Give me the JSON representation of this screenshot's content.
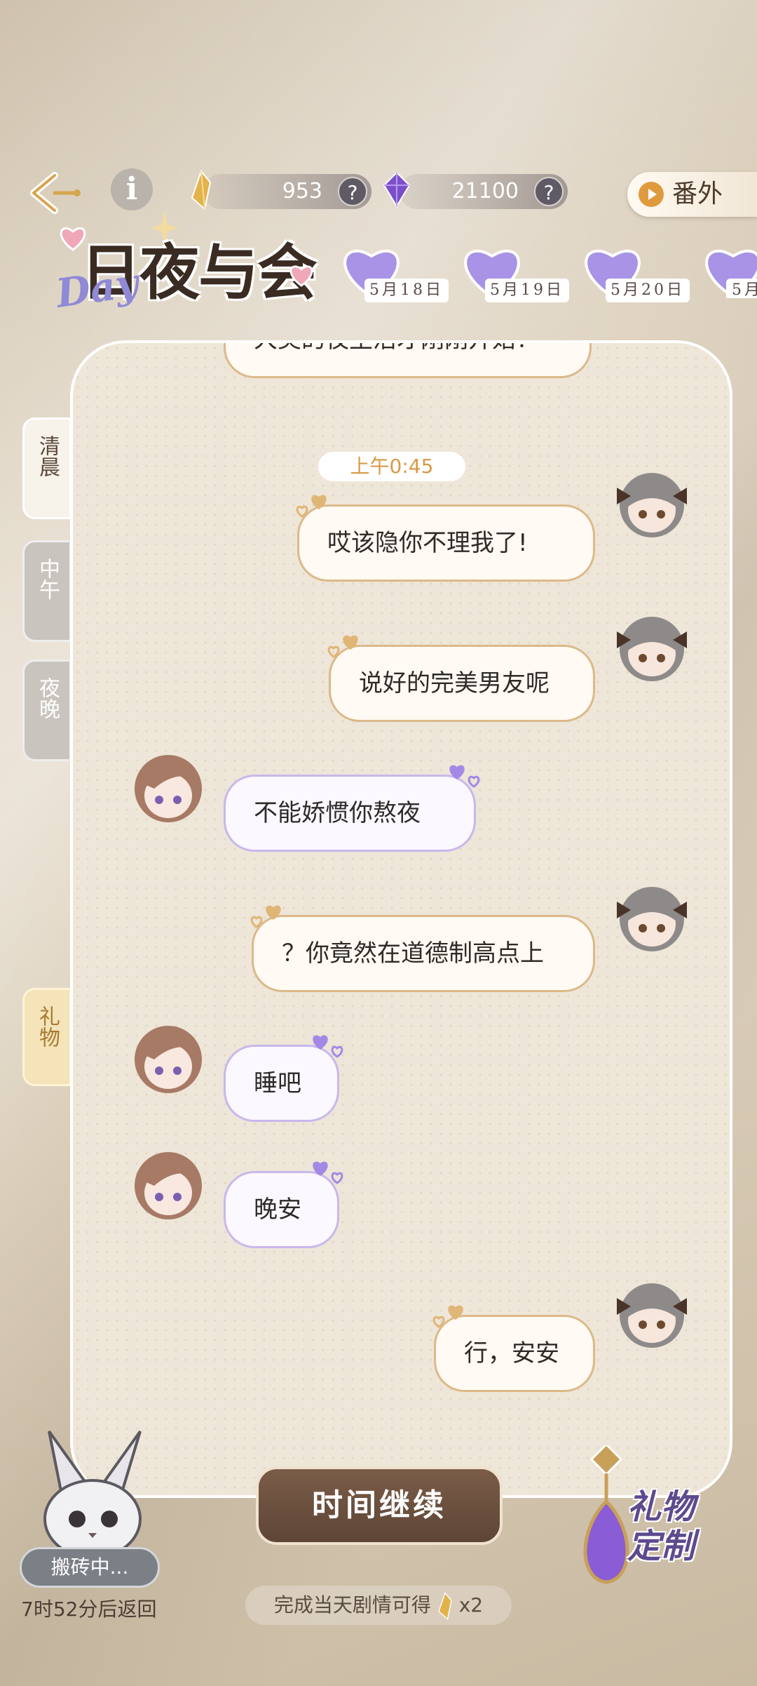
{
  "header": {
    "currency_gold": "953",
    "currency_gem": "21100",
    "help_symbol": "?",
    "extra_label": "番外",
    "logo_day": "Day",
    "logo_title": "日夜与会"
  },
  "dates": [
    "5月18日",
    "5月19日",
    "5月20日",
    "5月"
  ],
  "side_tabs": [
    "清晨",
    "中午",
    "夜晚",
    "礼物"
  ],
  "chat": {
    "timestamp": "上午0:45",
    "partial_top": "大美的夜生活才刚刚开始！",
    "messages": [
      {
        "side": "right",
        "text": "哎该隐你不理我了!"
      },
      {
        "side": "right",
        "text": "说好的完美男友呢"
      },
      {
        "side": "left",
        "text": "不能娇惯你熬夜"
      },
      {
        "side": "right",
        "text": "？你竟然在道德制高点上"
      },
      {
        "side": "left",
        "text": "睡吧"
      },
      {
        "side": "left",
        "text": "晚安"
      },
      {
        "side": "right",
        "text": "行，安安"
      }
    ]
  },
  "bottom": {
    "continue_label": "时间继续",
    "reward_hint": "完成当天剧情可得",
    "reward_multiplier": "x2",
    "status": "搬砖中...",
    "return_time": "7时52分后返回",
    "gift_custom_label": "礼物定制"
  },
  "colors": {
    "accent_gold": "#d89a46",
    "bubble_user_border": "#dcb98a",
    "bubble_other_border": "#c9b7ec",
    "continue_button": "#6b4f3e"
  }
}
